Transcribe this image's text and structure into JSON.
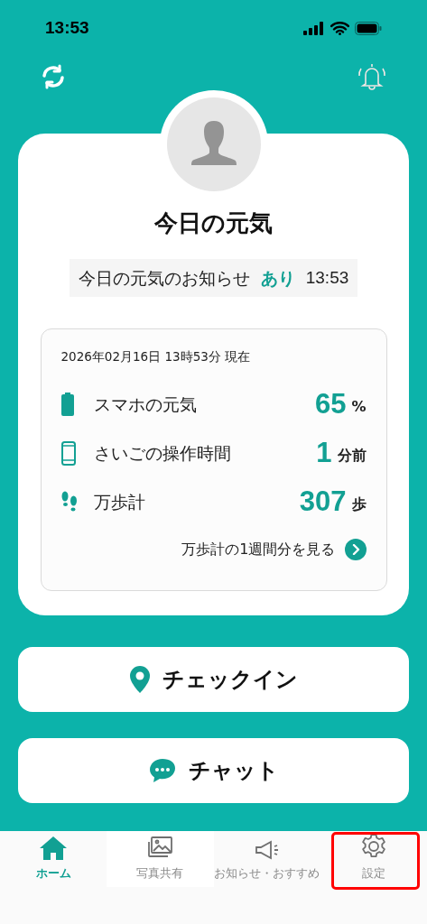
{
  "status_bar": {
    "time": "13:53"
  },
  "card": {
    "title": "今日の元気",
    "notice": {
      "label": "今日の元気のお知らせ",
      "value": "あり",
      "time": "13:53"
    },
    "stats": {
      "timestamp": "2026年02月16日 13時53分 現在",
      "rows": [
        {
          "kind": "battery",
          "label": "スマホの元気",
          "value": "65",
          "unit": "%"
        },
        {
          "kind": "phone",
          "label": "さいごの操作時間",
          "value": "1",
          "unit": "分前"
        },
        {
          "kind": "steps",
          "label": "万歩計",
          "value": "307",
          "unit": "歩"
        }
      ],
      "link": "万歩計の1週間分を見る"
    }
  },
  "actions": [
    {
      "kind": "pin",
      "label": "チェックイン"
    },
    {
      "kind": "chat",
      "label": "チャット"
    }
  ],
  "tab_bar": [
    {
      "kind": "home",
      "label": "ホーム",
      "selected": true,
      "highlighted": false
    },
    {
      "kind": "photo",
      "label": "写真共有",
      "selected": false,
      "highlighted": false
    },
    {
      "kind": "megaphone",
      "label": "お知らせ・おすすめ",
      "selected": false,
      "highlighted": false
    },
    {
      "kind": "gear",
      "label": "設定",
      "selected": false,
      "highlighted": true
    }
  ]
}
